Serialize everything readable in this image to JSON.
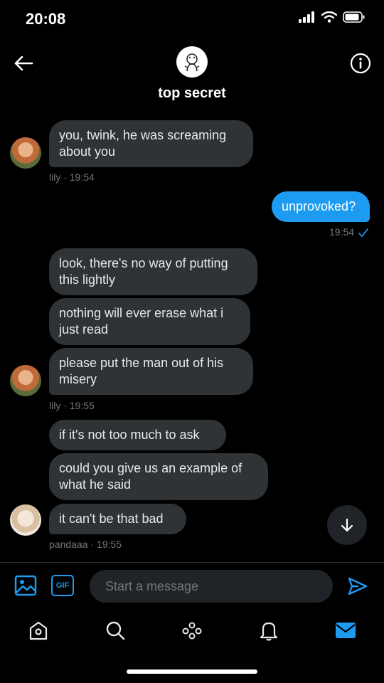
{
  "status_bar": {
    "time": "20:08"
  },
  "header": {
    "title": "top secret"
  },
  "messages": {
    "m1": {
      "text": "you, twink, he was screaming about you"
    },
    "m1_meta": "lily · 19:54",
    "m2": {
      "text": "unprovoked?"
    },
    "m2_meta": "19:54",
    "m3": {
      "text": "look, there's no way of putting this lightly"
    },
    "m4": {
      "text": "nothing will ever erase what i just read"
    },
    "m5": {
      "text": "please put the man out of his misery"
    },
    "m5_meta": "lily · 19:55",
    "m6": {
      "text": "if it's not too much to ask"
    },
    "m7": {
      "text": "could you give us an example of what he said"
    },
    "m8": {
      "text": "it can't be that bad"
    },
    "m8_meta": "pandaaa · 19:55"
  },
  "compose": {
    "gif_label": "GIF",
    "placeholder": "Start a message"
  },
  "colors": {
    "accent": "#1d9bf0",
    "bubble_in": "#2f3336",
    "background": "#000000",
    "meta_text": "#71767b"
  },
  "icons": [
    "back-arrow-icon",
    "info-icon",
    "image-icon",
    "gif-icon",
    "send-icon",
    "home-icon",
    "search-icon",
    "communities-icon",
    "notifications-icon",
    "messages-icon",
    "arrow-down-icon"
  ]
}
